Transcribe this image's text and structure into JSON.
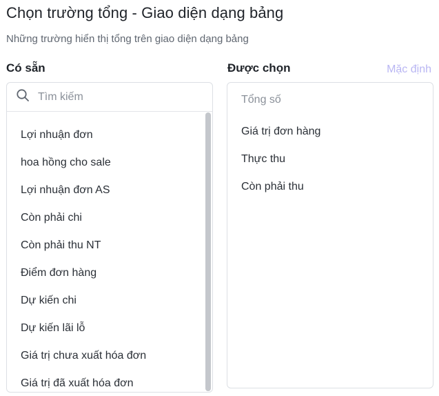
{
  "header": {
    "title": "Chọn trường tổng - Giao diện dạng bảng",
    "subtitle": "Những trường hiển thị tổng trên giao diện dạng bảng"
  },
  "available": {
    "label": "Có sẵn",
    "search_placeholder": "Tìm kiếm",
    "search_value": "",
    "items": [
      "Lợi nhuận đơn",
      "hoa hồng cho sale",
      "Lợi nhuận đơn AS",
      "Còn phải chi",
      "Còn phải thu NT",
      "Điểm đơn hàng",
      "Dự kiến chi",
      "Dự kiến lãi lỗ",
      "Giá trị chưa xuất hóa đơn",
      "Giá trị đã xuất hóa đơn"
    ]
  },
  "selected": {
    "label": "Được chọn",
    "default_link": "Mặc định",
    "total_label": "Tổng số",
    "items": [
      "Giá trị đơn hàng",
      "Thực thu",
      "Còn phải thu"
    ]
  },
  "colors": {
    "accent_link": "#b9b6f3",
    "border": "#dcdfe4",
    "scrollbar": "#c4c7cc"
  },
  "icons": {
    "search": "search-icon"
  }
}
